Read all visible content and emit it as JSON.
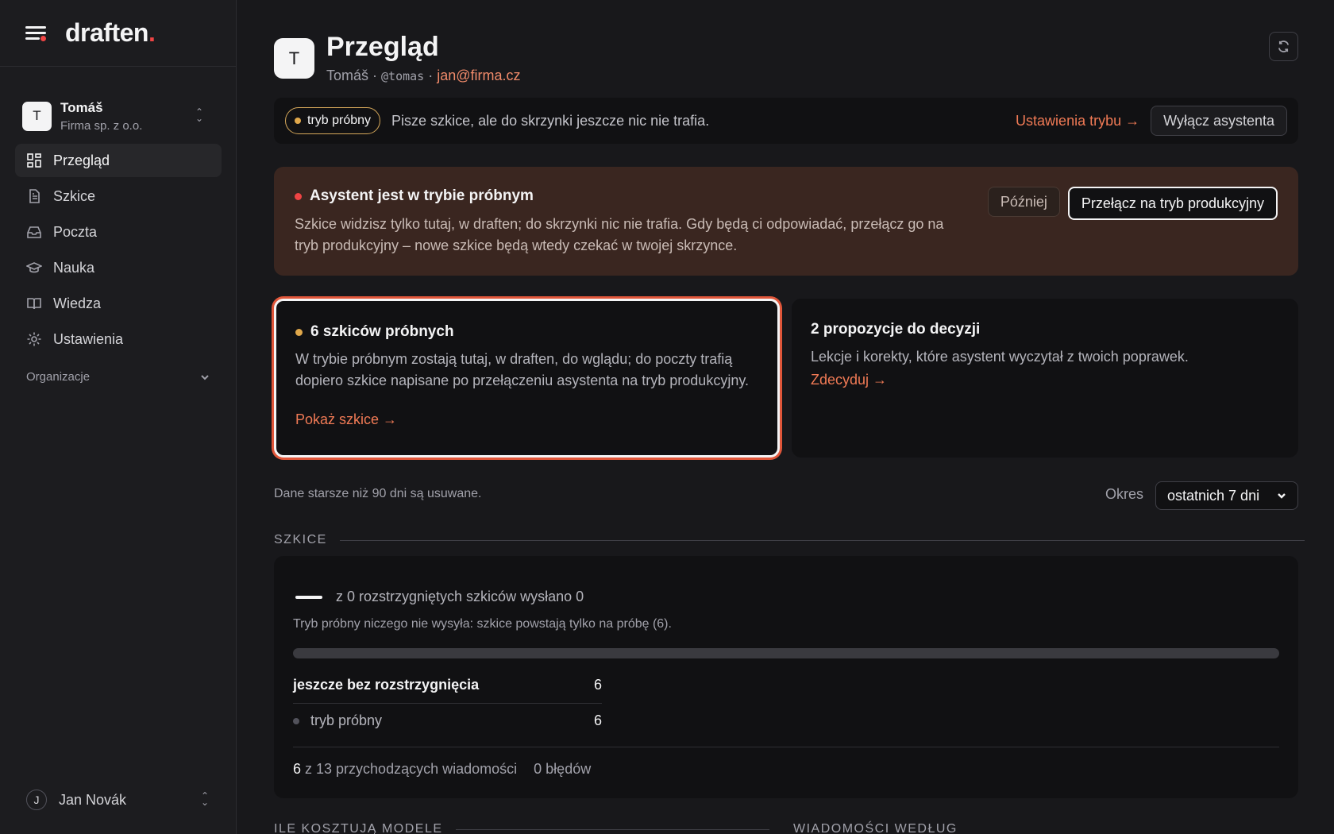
{
  "brand": {
    "name": "draften",
    "dot": "."
  },
  "account": {
    "initial": "T",
    "name": "Tomáš",
    "org": "Firma sp. z o.o."
  },
  "nav": [
    {
      "label": "Przegląd",
      "icon": "grid-icon",
      "active": true
    },
    {
      "label": "Szkice",
      "icon": "document-icon",
      "active": false
    },
    {
      "label": "Poczta",
      "icon": "inbox-icon",
      "active": false
    },
    {
      "label": "Nauka",
      "icon": "graduation-cap-icon",
      "active": false
    },
    {
      "label": "Wiedza",
      "icon": "book-icon",
      "active": false
    },
    {
      "label": "Ustawienia",
      "icon": "gear-icon",
      "active": false
    }
  ],
  "organizations_label": "Organizacje",
  "user": {
    "initial": "J",
    "name": "Jan Novák"
  },
  "header": {
    "initial": "T",
    "title": "Przegląd",
    "name": "Tomáš",
    "handle": "@tomas",
    "email": "jan@firma.cz",
    "sep": " · "
  },
  "mode": {
    "badge": "tryb próbny",
    "text": "Pisze szkice, ale do skrzynki jeszcze nic nie trafia.",
    "settings_link": "Ustawienia trybu →",
    "disable_button": "Wyłącz asystenta"
  },
  "alert": {
    "title": "Asystent jest w trybie próbnym",
    "text": "Szkice widzisz tylko tutaj, w draften; do skrzynki nic nie trafia. Gdy będą ci odpowiadać, przełącz go na tryb produkcyjny – nowe szkice będą wtedy czekać w twojej skrzynce.",
    "later_button": "Później",
    "switch_button": "Przełącz na tryb produkcyjny"
  },
  "cards": {
    "trial": {
      "title": "6 szkiców próbnych",
      "text": "W trybie próbnym zostają tutaj, w draften, do wglądu; do poczty trafią dopiero szkice napisane po przełączeniu asystenta na tryb produkcyjny.",
      "link": "Pokaż szkice →"
    },
    "proposals": {
      "title": "2 propozycje do decyzji",
      "text": "Lekcje i korekty, które asystent wyczytał z twoich poprawek.",
      "link": "Zdecyduj →"
    }
  },
  "retention_note": "Dane starsze niż 90 dni są usuwane.",
  "period": {
    "label": "Okres",
    "selected": "ostatnich 7 dni"
  },
  "drafts_section": {
    "heading": "SZKICE",
    "summary": "z 0 rozstrzygniętych szkiców wysłano 0",
    "note": "Tryb próbny niczego nie wysyła: szkice powstają tylko na próbę (6).",
    "progress": 0,
    "rows": [
      {
        "label": "jeszcze bez rozstrzygnięcia",
        "value": "6"
      },
      {
        "label": "tryb próbny",
        "value": "6"
      }
    ],
    "footer_count": "6",
    "footer_rest": " z 13 przychodzących wiadomości",
    "footer_errors": "0 błędów"
  },
  "bottom_sections": {
    "left": "ILE KOSZTUJĄ MODELE",
    "right": "WIADOMOŚCI WEDŁUG STATUSU"
  }
}
